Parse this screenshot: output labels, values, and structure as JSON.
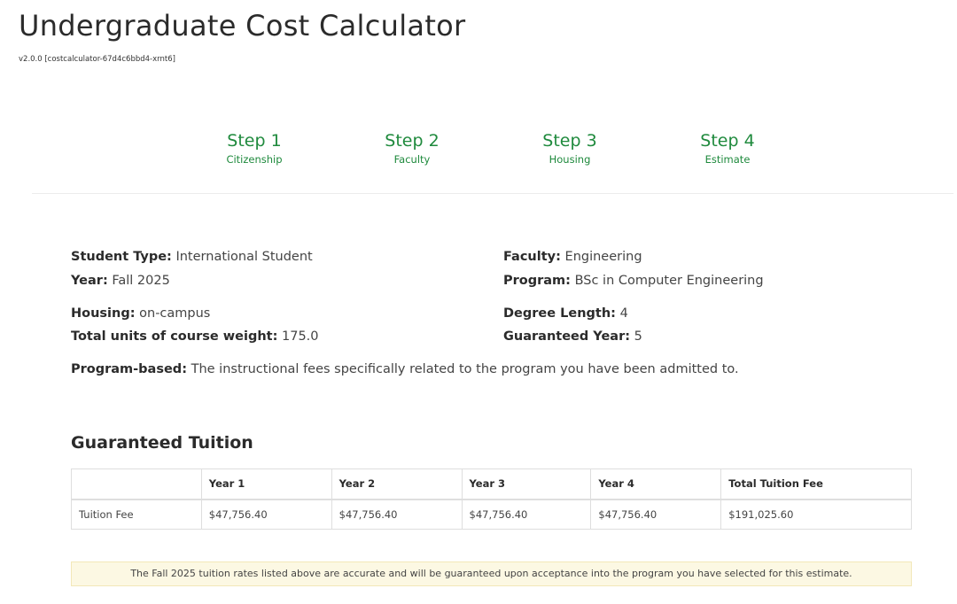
{
  "header": {
    "title": "Undergraduate Cost Calculator",
    "version": "v2.0.0 [costcalculator-67d4c6bbd4-xrnt6]"
  },
  "steps": [
    {
      "title": "Step 1",
      "subtitle": "Citizenship"
    },
    {
      "title": "Step 2",
      "subtitle": "Faculty"
    },
    {
      "title": "Step 3",
      "subtitle": "Housing"
    },
    {
      "title": "Step 4",
      "subtitle": "Estimate"
    }
  ],
  "summary": {
    "student_type": {
      "label": "Student Type:",
      "value": "International Student"
    },
    "year": {
      "label": "Year:",
      "value": "Fall 2025"
    },
    "faculty": {
      "label": "Faculty:",
      "value": "Engineering"
    },
    "program": {
      "label": "Program:",
      "value": "BSc in Computer Engineering"
    },
    "housing": {
      "label": "Housing:",
      "value": "on-campus"
    },
    "total_units": {
      "label": "Total units of course weight:",
      "value": "175.0"
    },
    "degree_length": {
      "label": "Degree Length:",
      "value": "4"
    },
    "guaranteed_year": {
      "label": "Guaranteed Year:",
      "value": "5"
    },
    "program_based": {
      "label": "Program-based:",
      "value": "The instructional fees specifically related to the program you have been admitted to."
    }
  },
  "tuition": {
    "title": "Guaranteed Tuition",
    "headers": [
      "",
      "Year 1",
      "Year 2",
      "Year 3",
      "Year 4",
      "Total Tuition Fee"
    ],
    "rows": [
      [
        "Tuition Fee",
        "$47,756.40",
        "$47,756.40",
        "$47,756.40",
        "$47,756.40",
        "$191,025.60"
      ]
    ],
    "notice": "The Fall 2025 tuition rates listed above are accurate and will be guaranteed upon acceptance into the program you have selected for this estimate."
  },
  "colors": {
    "step_accent": "#1f8a3d",
    "notice_bg": "#fcf8e3"
  }
}
